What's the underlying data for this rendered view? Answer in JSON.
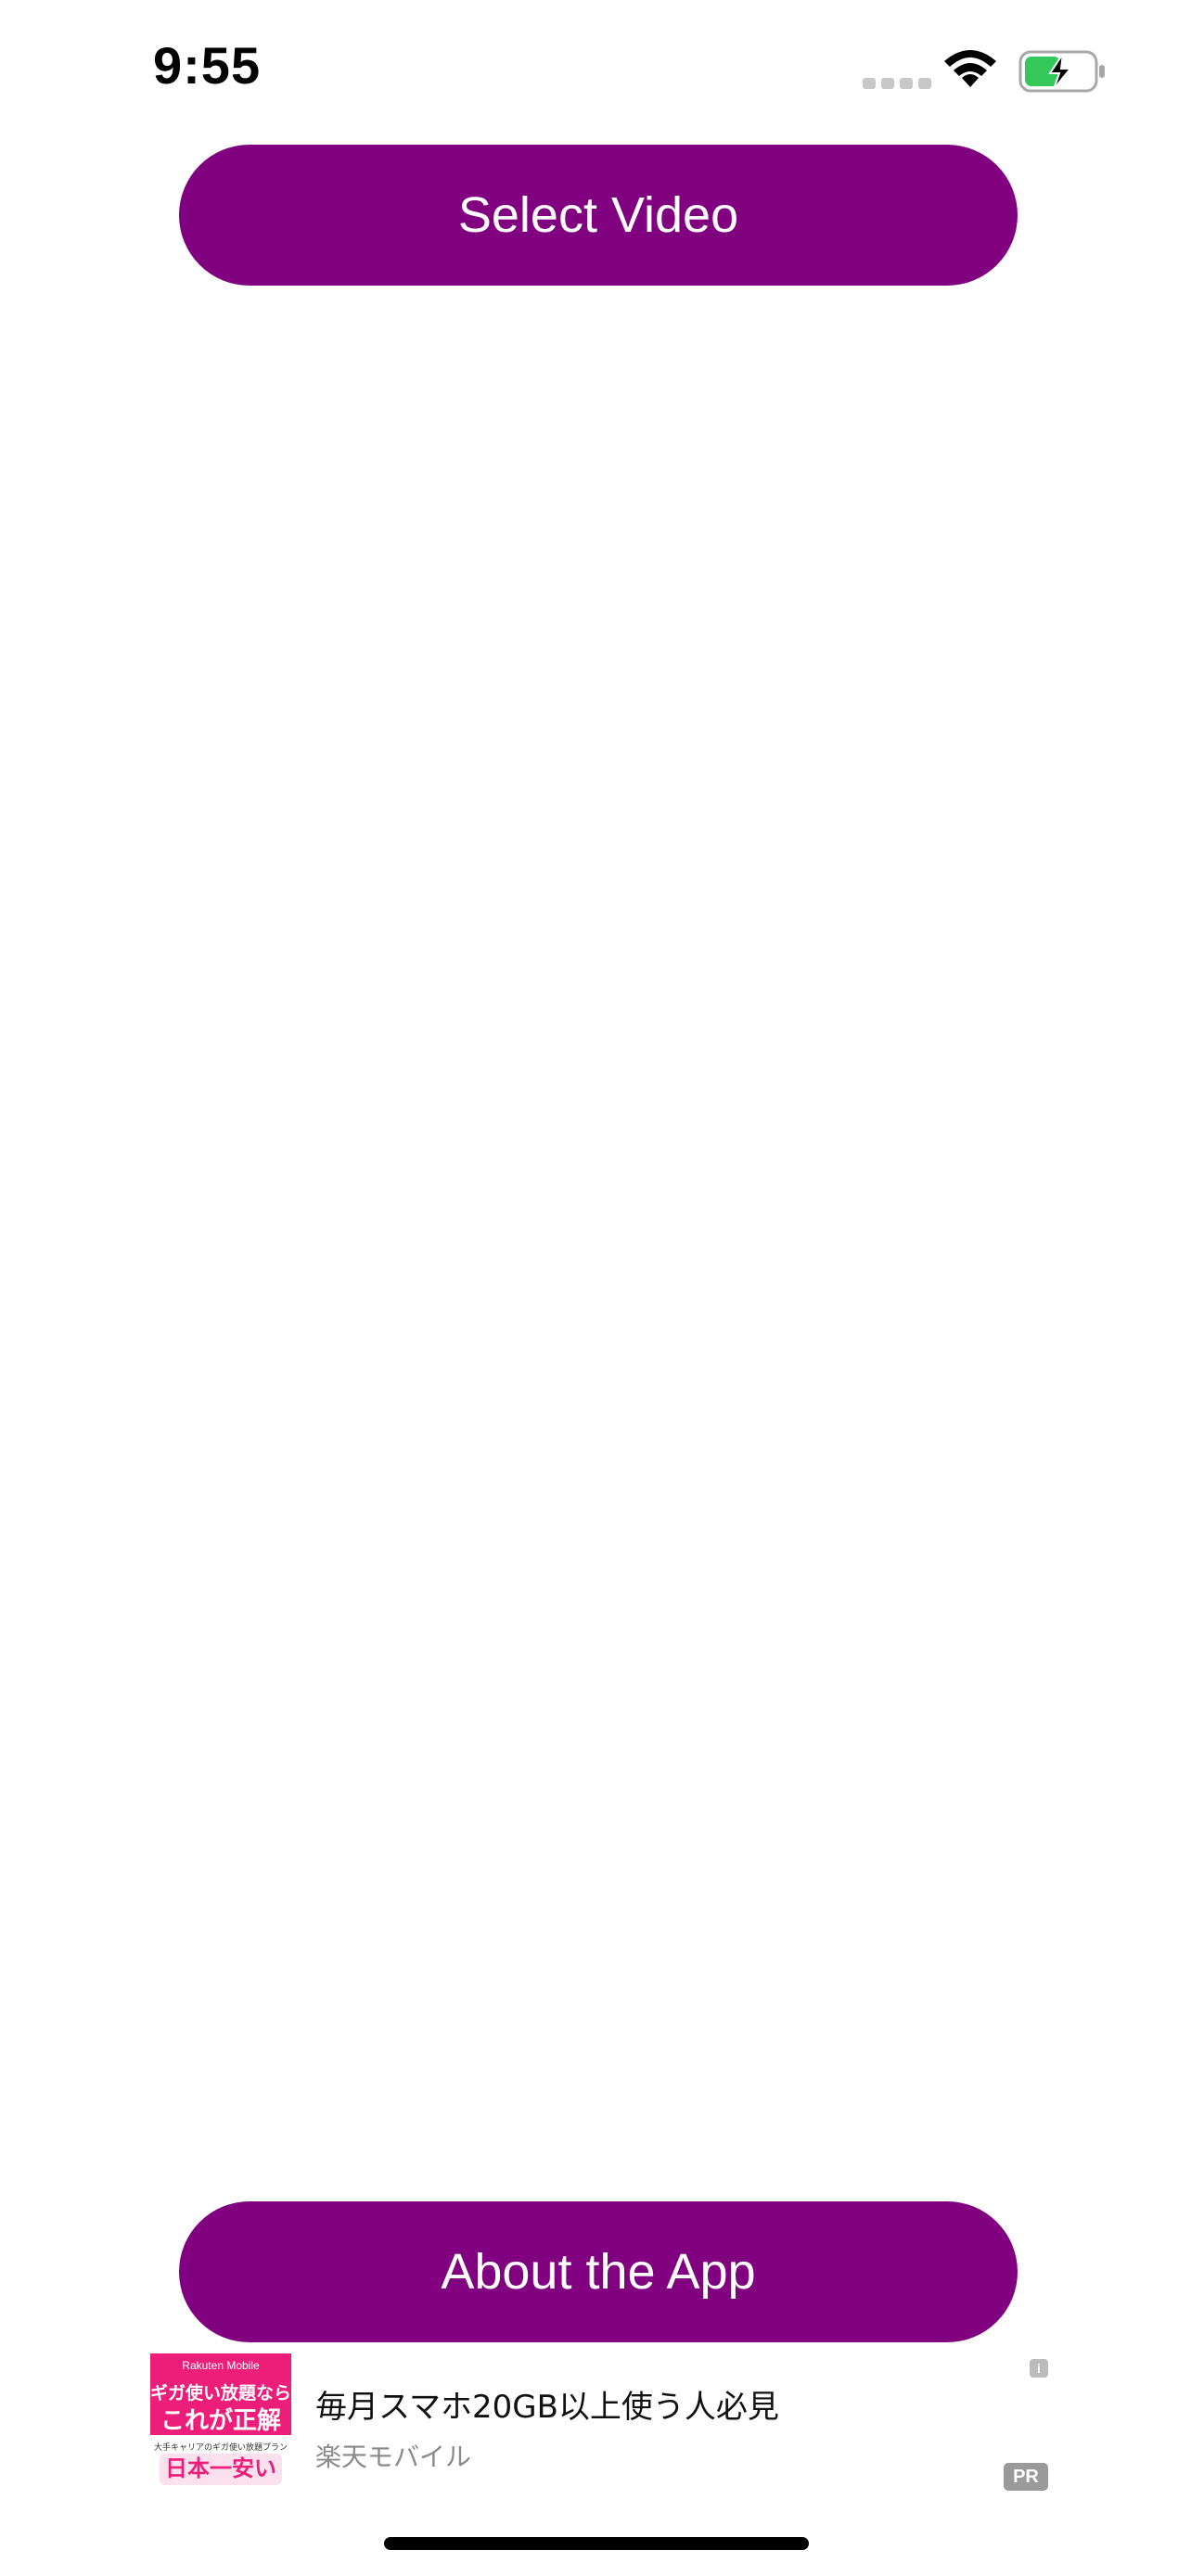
{
  "status_bar": {
    "time": "9:55",
    "icons": [
      "signal-icon",
      "wifi-icon",
      "battery-charging-icon"
    ],
    "battery_color": "#34c759"
  },
  "buttons": {
    "select_video": "Select Video",
    "about_app": "About the App"
  },
  "ad": {
    "thumbnail": {
      "brand": "Rakuten Mobile",
      "headline_line1": "ギガ使い放題なら",
      "headline_line2": "これが正解",
      "subline": "大手キャリアのギガ使い放題プランで",
      "tagline": "日本一安い"
    },
    "title": "毎月スマホ20GB以上使う人必見",
    "advertiser": "楽天モバイル",
    "info_label": "i",
    "pr_label": "PR"
  },
  "colors": {
    "accent": "#800080",
    "background": "#ffffff",
    "ad_brand": "#ec1e79"
  }
}
